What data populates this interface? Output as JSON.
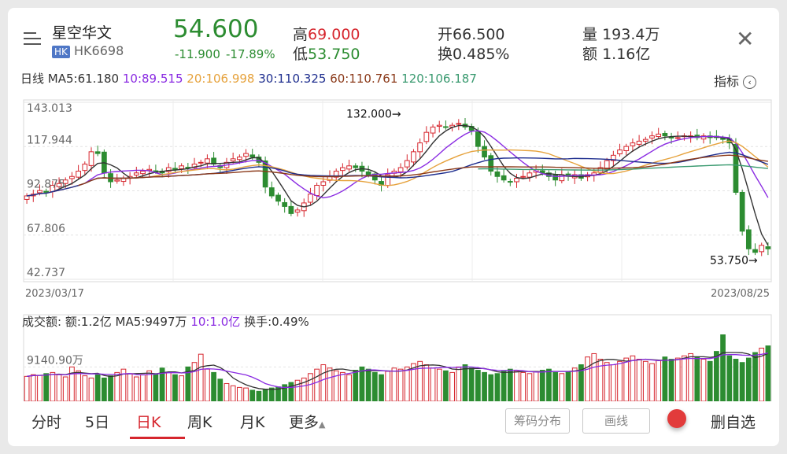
{
  "header": {
    "stock_name": "星空华文",
    "market_badge": "HK",
    "stock_code": "HK6698",
    "price": "54.600",
    "change": "-11.900",
    "change_pct": "-17.89%",
    "high_label": "高",
    "high_value": "69.000",
    "low_label": "低",
    "low_value": "53.750",
    "open_label": "开",
    "open_value": "66.500",
    "turnover_label": "换",
    "turnover_value": "0.485%",
    "volume_label": "量",
    "volume_value": "193.4万",
    "amount_label": "额",
    "amount_value": "1.16亿",
    "close_icon": "close-icon",
    "menu_icon": "menu-lines-icon"
  },
  "ma_bar": {
    "period": "日线",
    "ma5": "MA5:61.180",
    "ma10": "10:89.515",
    "ma20": "20:106.998",
    "ma30": "30:110.325",
    "ma60": "60:110.761",
    "ma120": "120:106.187",
    "indicator_label": "指标"
  },
  "colors": {
    "up": "#d6262e",
    "down": "#2c8c31",
    "ma5": "#333333",
    "ma10": "#8a2be2",
    "ma20": "#e6a23c",
    "ma30": "#1f2f8f",
    "ma60": "#8b3a1a",
    "ma120": "#3a9a70"
  },
  "price_chart": {
    "y_labels": [
      "143.013",
      "117.944",
      "92.875",
      "67.806",
      "42.737"
    ],
    "start_date": "2023/03/17",
    "end_date": "2023/08/25",
    "max_annotation": "132.000→",
    "min_annotation": "53.750→"
  },
  "volume_chart": {
    "header_title": "成交额:",
    "amount": "额:1.2亿",
    "ma5": "MA5:9497万",
    "ma10": "10:1.0亿",
    "turnover": "换手:0.49%",
    "y_label": "9140.90万"
  },
  "tabs": [
    "分时",
    "5日",
    "日K",
    "周K",
    "月K",
    "更多"
  ],
  "active_tab": "日K",
  "buttons": {
    "chips": "筹码分布",
    "draw": "画线",
    "remove_watch": "删自选"
  },
  "chart_data": [
    {
      "type": "candlestick",
      "title": "",
      "x_range": [
        "2023/03/17",
        "2023/08/25"
      ],
      "ylim": [
        42.737,
        143.013
      ],
      "y_ticks": [
        143.013,
        117.944,
        92.875,
        67.806,
        42.737
      ],
      "close": [
        90,
        91,
        93,
        92,
        96,
        97,
        99,
        101,
        104,
        108,
        115,
        114,
        103,
        98,
        99,
        100,
        101,
        103,
        104,
        105,
        104,
        103,
        106,
        105,
        107,
        106,
        108,
        109,
        111,
        108,
        106,
        109,
        111,
        112,
        114,
        112,
        109,
        95,
        90,
        87,
        84,
        80,
        82,
        86,
        91,
        96,
        98,
        101,
        104,
        106,
        107,
        106,
        104,
        102,
        99,
        96,
        102,
        104,
        106,
        110,
        115,
        120,
        126,
        129,
        130,
        129,
        130,
        131,
        129,
        127,
        118,
        112,
        104,
        101,
        99,
        98,
        100,
        101,
        103,
        105,
        103,
        101,
        99,
        102,
        101,
        102,
        100,
        102,
        103,
        106,
        110,
        113,
        116,
        118,
        120,
        121,
        122,
        124,
        125,
        124,
        123,
        123,
        124,
        124,
        123,
        124,
        123,
        123,
        122,
        120,
        92,
        70,
        60,
        58,
        62,
        60
      ],
      "series": [
        {
          "name": "MA5",
          "value": 61.18
        },
        {
          "name": "10",
          "value": 89.515
        },
        {
          "name": "20",
          "value": 106.998
        },
        {
          "name": "30",
          "value": 110.325
        },
        {
          "name": "60",
          "value": 110.761
        },
        {
          "name": "120",
          "value": 106.187
        }
      ],
      "annotations": [
        {
          "text": "132.000→",
          "value": 132.0
        },
        {
          "text": "53.750→",
          "value": 53.75
        }
      ]
    },
    {
      "type": "bar",
      "title": "",
      "y_ticks_label": "9140.90万",
      "volume_values": [
        45,
        48,
        47,
        50,
        52,
        48,
        44,
        62,
        55,
        46,
        42,
        48,
        42,
        46,
        52,
        58,
        50,
        44,
        48,
        55,
        50,
        60,
        52,
        48,
        46,
        62,
        70,
        85,
        58,
        52,
        40,
        32,
        28,
        25,
        24,
        20,
        18,
        22,
        24,
        26,
        30,
        34,
        38,
        42,
        50,
        58,
        66,
        60,
        55,
        52,
        48,
        56,
        62,
        58,
        52,
        48,
        54,
        60,
        58,
        62,
        68,
        72,
        66,
        60,
        58,
        55,
        52,
        62,
        66,
        60,
        56,
        52,
        48,
        50,
        54,
        58,
        55,
        52,
        50,
        54,
        56,
        58,
        52,
        50,
        54,
        60,
        66,
        80,
        86,
        76,
        70,
        66,
        72,
        78,
        82,
        76,
        72,
        68,
        74,
        80,
        76,
        78,
        82,
        86,
        80,
        76,
        72,
        90,
        120,
        82,
        76,
        70,
        78,
        88,
        96,
        100
      ]
    }
  ]
}
